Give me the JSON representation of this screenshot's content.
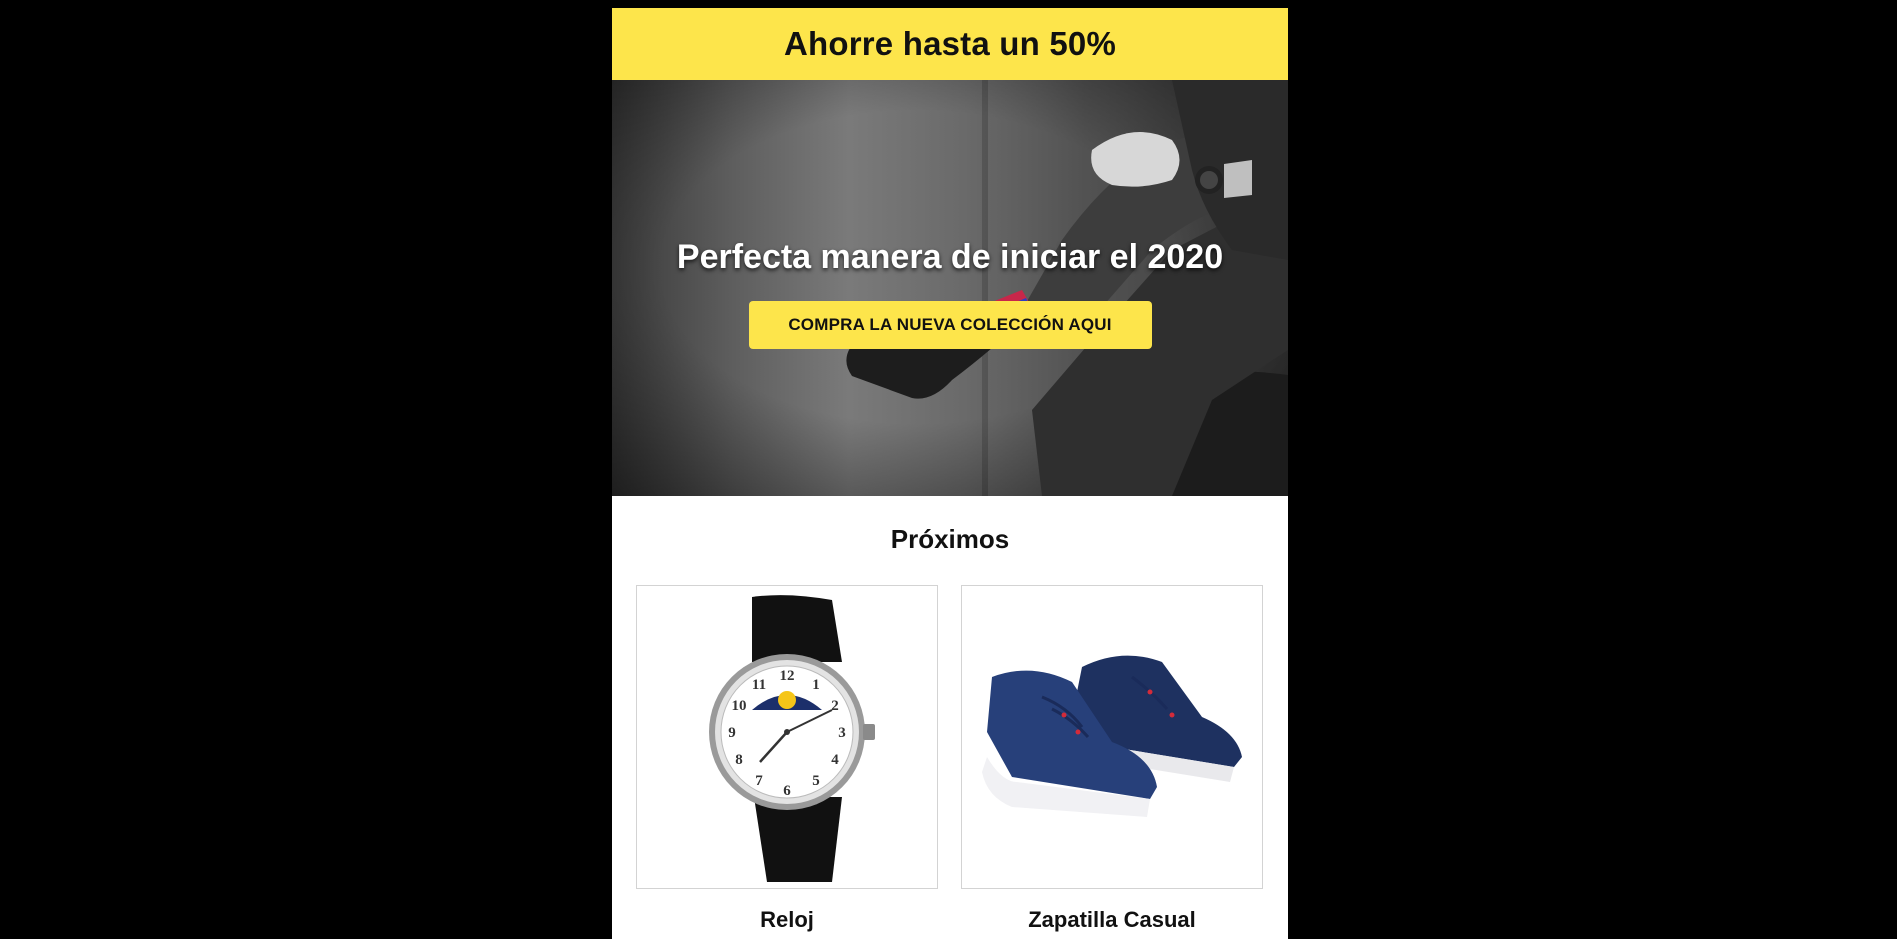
{
  "promo": {
    "headline": "Ahorre hasta un 50%"
  },
  "hero": {
    "title": "Perfecta manera de iniciar el 2020",
    "cta_label": "COMPRA LA NUEVA COLECCIÓN AQUI"
  },
  "upcoming": {
    "title": "Próximos",
    "products": [
      {
        "name": "Reloj",
        "icon": "wristwatch-image"
      },
      {
        "name": "Zapatilla Casual",
        "icon": "sneakers-image"
      }
    ]
  },
  "colors": {
    "accent": "#fde54b",
    "page_background": "#000000",
    "email_background": "#ffffff"
  }
}
